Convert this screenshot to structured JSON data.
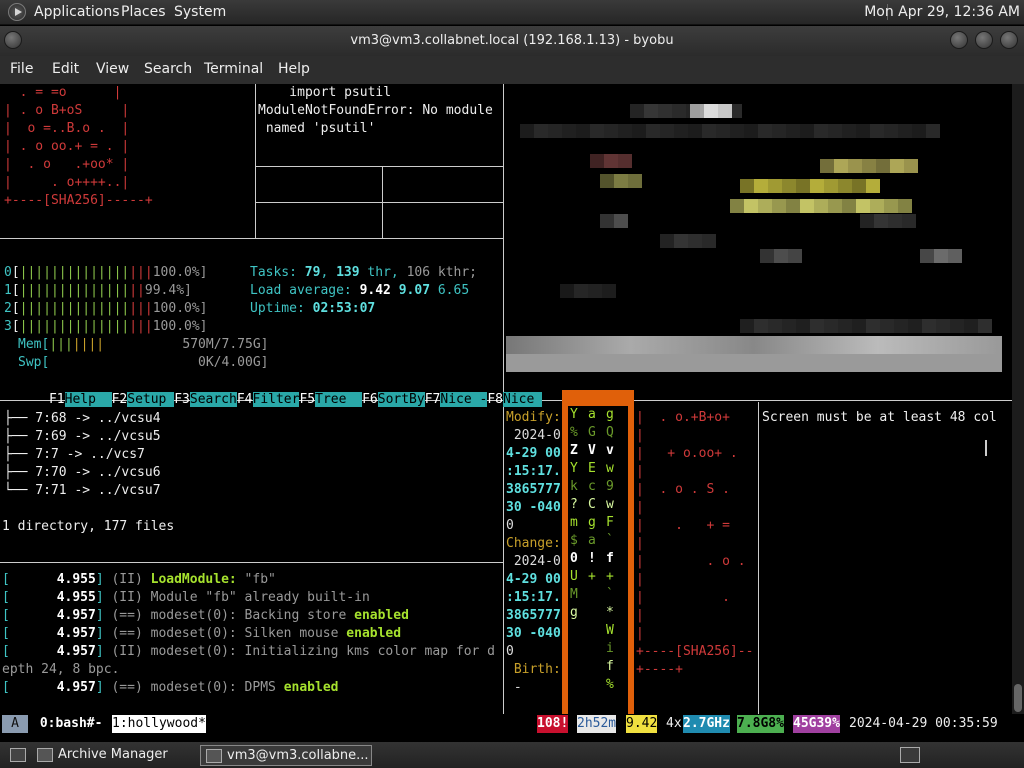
{
  "top_panel": {
    "menus": [
      "Applications",
      "Places",
      "System"
    ],
    "clock": "Mon Apr 29, 12:36 AM"
  },
  "window": {
    "title": "vm3@vm3.collabnet.local (192.168.1.13) - byobu"
  },
  "menubar": [
    "File",
    "Edit",
    "View",
    "Search",
    "Terminal",
    "Help"
  ],
  "pane_randomart": {
    "lines": [
      "  . = =o      |",
      "| . o B+oS     |",
      "|  o =..B.o .  |",
      "| . o oo.+ = . |",
      "|  . o   .+oo* |",
      "|     . o++++..|",
      "+----[SHA256]-----+"
    ]
  },
  "pane_python": {
    "lines": [
      "    import psutil",
      "ModuleNotFoundError: No module",
      " named 'psutil'"
    ]
  },
  "htop": {
    "cpus": [
      {
        "id": "0",
        "bar": "[|||||||||||||||||",
        "pct": "100.0%]"
      },
      {
        "id": "1",
        "bar": "[||||||||||||||||",
        "pct": "99.4%]"
      },
      {
        "id": "2",
        "bar": "[|||||||||||||||||",
        "pct": "100.0%]"
      },
      {
        "id": "3",
        "bar": "[|||||||||||||||||",
        "pct": "100.0%]"
      }
    ],
    "mem_label": "Mem[",
    "mem_bar": "|||||||",
    "mem_value": "570M/7.75G]",
    "swp_label": "Swp[",
    "swp_value": "0K/4.00G]",
    "tasks_label": "Tasks:",
    "tasks": "79",
    "thr": "139",
    "thr_label": "thr,",
    "kthr": "106 kthr;",
    "load_label": "Load average:",
    "load1": "9.42",
    "load5": "9.07",
    "load15": "6.65",
    "uptime_label": "Uptime:",
    "uptime": "02:53:07",
    "fkeys": [
      {
        "key": "F1",
        "label": "Help  "
      },
      {
        "key": "F2",
        "label": "Setup "
      },
      {
        "key": "F3",
        "label": "Search"
      },
      {
        "key": "F4",
        "label": "Filter"
      },
      {
        "key": "F5",
        "label": "Tree  "
      },
      {
        "key": "F6",
        "label": "SortBy"
      },
      {
        "key": "F7",
        "label": "Nice -"
      },
      {
        "key": "F8",
        "label": "Nice "
      }
    ]
  },
  "tree": {
    "lines": [
      "├── 7:68 -> ../vcsu4",
      "├── 7:69 -> ../vcsu5",
      "├── 7:7 -> ../vcs7",
      "├── 7:70 -> ../vcsu6",
      "└── 7:71 -> ../vcsu7"
    ],
    "summary": "1 directory, 177 files"
  },
  "xorg_log": {
    "lines": [
      {
        "ts": "4.955",
        "tag": "(II)",
        "text": "LoadModule: ",
        "bold": "",
        "quote": "\"fb\"",
        "rest": ""
      },
      {
        "ts": "4.955",
        "tag": "(II)",
        "text": "Module \"fb\" already built-in",
        "bold": "",
        "quote": "",
        "rest": ""
      },
      {
        "ts": "4.957",
        "tag": "(==)",
        "text": "modeset(0): Backing store ",
        "bold": "enabled",
        "quote": "",
        "rest": ""
      },
      {
        "ts": "4.957",
        "tag": "(==)",
        "text": "modeset(0): Silken mouse ",
        "bold": "enabled",
        "quote": "",
        "rest": ""
      },
      {
        "ts": "4.957",
        "tag": "(II)",
        "text": "modeset(0): Initializing kms color map for d",
        "bold": "",
        "quote": "",
        "rest": ""
      },
      {
        "ts": "",
        "tag": "",
        "text": "epth 24, 8 bpc.",
        "bold": "",
        "quote": "",
        "rest": ""
      },
      {
        "ts": "4.957",
        "tag": "(==)",
        "text": "modeset(0): DPMS ",
        "bold": "enabled",
        "quote": "",
        "rest": ""
      }
    ]
  },
  "stat_pane": {
    "lines": [
      "Modify:",
      " 2024-0",
      "4-29 00",
      ":15:17.",
      "3865777",
      "30 -040",
      "0",
      "Change:",
      " 2024-0",
      "4-29 00",
      ":15:17.",
      "3865777",
      "30 -040",
      "0",
      " Birth:",
      " -"
    ]
  },
  "matrix": {
    "cols": [
      [
        "Y",
        "%",
        "Z",
        "Y",
        "k",
        "?",
        "m",
        "$",
        "0",
        "U",
        "M",
        "g",
        "",
        "",
        "",
        ""
      ],
      [
        "a",
        "G",
        "V",
        "E",
        "c",
        "C",
        "g",
        "a",
        "!",
        "+",
        "",
        "",
        "",
        "",
        "",
        ""
      ],
      [
        "g",
        "Q",
        "v",
        "w",
        "9",
        "w",
        "F",
        "`",
        "f",
        "+",
        "`",
        "*",
        "W",
        "i",
        "f",
        "%"
      ]
    ]
  },
  "randomart2": {
    "lines": [
      "|  . o.+B+o+ ",
      "|            ",
      "|   + o.oo+ .",
      "|            ",
      "|  . o . S .",
      "|            ",
      "|    .   + = ",
      "|            ",
      "|        . o .",
      "|            ",
      "|          .",
      "|            ",
      "|            ",
      "+----[SHA256]--",
      "+----+"
    ]
  },
  "screen_msg": "Screen must be at least 48 col",
  "statusbar": {
    "session": "A",
    "win0": " 0:bash#- ",
    "win1": "1:hollywood*",
    "procs": "108!",
    "uptime": "2h52m",
    "load": "9.42",
    "cpu_count": "4x",
    "cpu_freq": "2.7GHz",
    "mem": "7.8G8%",
    "disk": "45G39%",
    "datetime": "2024-04-29 00:35:59"
  },
  "taskbar": [
    {
      "label": "Archive Manager",
      "active": false
    },
    {
      "label": "vm3@vm3.collabne...",
      "active": true
    }
  ]
}
